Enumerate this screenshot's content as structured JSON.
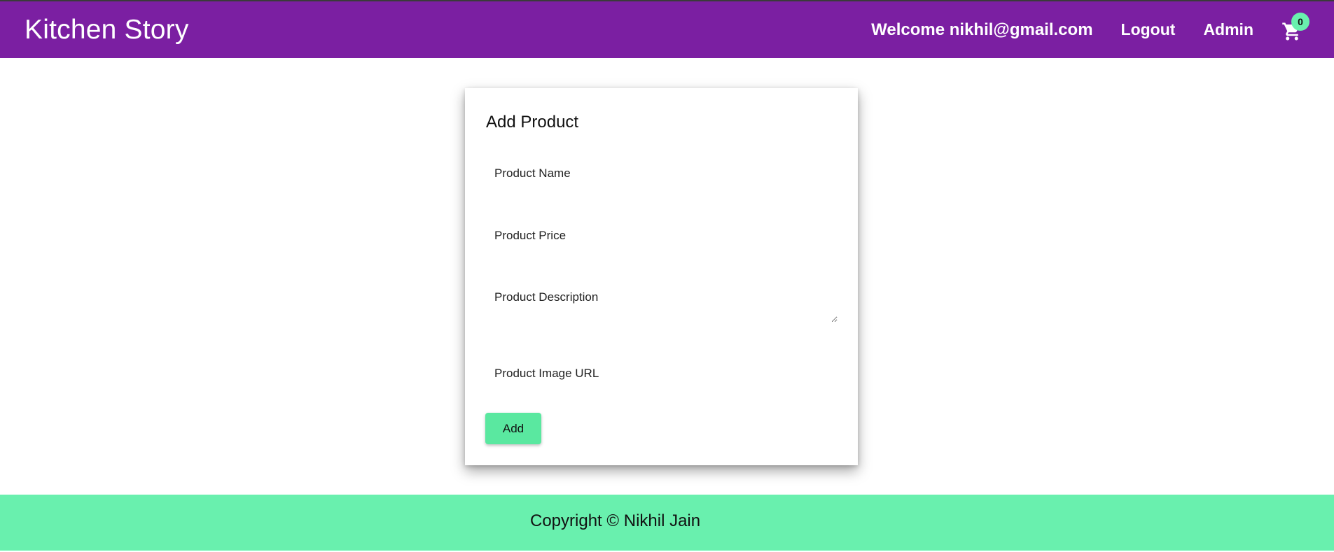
{
  "header": {
    "brand": "Kitchen Story",
    "welcome": "Welcome nikhil@gmail.com",
    "logout_label": "Logout",
    "admin_label": "Admin",
    "cart_icon": "shopping-cart-icon",
    "cart_count": "0"
  },
  "form": {
    "title": "Add Product",
    "fields": {
      "name": {
        "placeholder": "Product Name",
        "value": ""
      },
      "price": {
        "placeholder": "Product Price",
        "value": ""
      },
      "description": {
        "placeholder": "Product Description",
        "value": ""
      },
      "image_url": {
        "placeholder": "Product Image URL",
        "value": ""
      }
    },
    "submit_label": "Add"
  },
  "footer": {
    "copyright": "Copyright © Nikhil Jain"
  },
  "colors": {
    "header_bg": "#7b1fa2",
    "accent_green": "#69f0ae",
    "button_green": "#5ae8a0"
  }
}
